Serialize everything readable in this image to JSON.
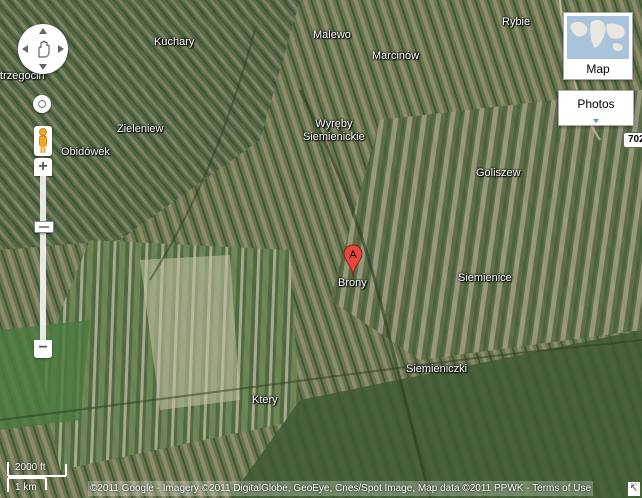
{
  "map": {
    "type_active": "Satellite",
    "places": [
      {
        "name": "Rybie"
      },
      {
        "name": "Kuchary"
      },
      {
        "name": "Malewo"
      },
      {
        "name": "Marcinów"
      },
      {
        "name": "trzegocin"
      },
      {
        "name": "Zieleniew"
      },
      {
        "name": "Wyręby\nSiemienickie"
      },
      {
        "name": "Obidówek"
      },
      {
        "name": "Goliszew"
      },
      {
        "name": "Brony"
      },
      {
        "name": "Siemienice"
      },
      {
        "name": "Siemieniczki"
      },
      {
        "name": "Ktery"
      }
    ],
    "marker": {
      "label": "A",
      "color": "#e8473b"
    },
    "road_shield": "702"
  },
  "controls": {
    "pan_icon": "hand-icon",
    "zoom_in_label": "+",
    "zoom_out_label": "−",
    "zoom_level_fraction": 0.29,
    "map_type_label": "Map",
    "photos_label": "Photos"
  },
  "scale": {
    "imperial": "2000 ft",
    "metric": "1 km"
  },
  "footer": {
    "copyright": "©2011 Google - Imagery ©2011 DigitalGlobe, GeoEye, Cnes/Spot Image, Map data ©2011 PPWK - ",
    "terms": "Terms of Use"
  }
}
